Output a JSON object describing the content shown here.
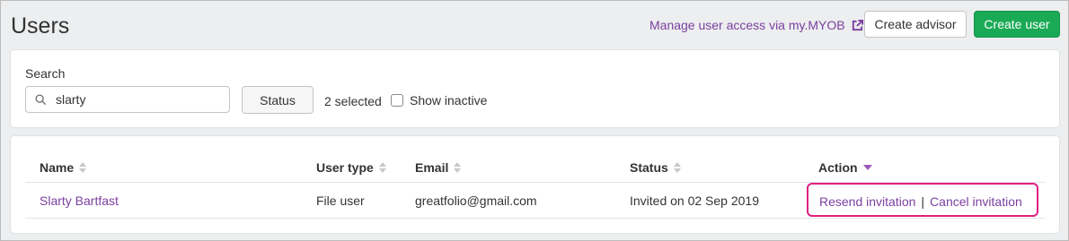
{
  "header": {
    "title": "Users",
    "manage_link": "Manage user access via my.MYOB",
    "create_advisor": "Create advisor",
    "create_user": "Create user"
  },
  "search": {
    "label": "Search",
    "value": "slarty",
    "status_button": "Status",
    "selected_count": "2 selected",
    "show_inactive": "Show inactive"
  },
  "table": {
    "columns": [
      "Name",
      "User type",
      "Email",
      "Status",
      "Action"
    ],
    "rows": [
      {
        "name": "Slarty Bartfast",
        "user_type": "File user",
        "email": "greatfolio@gmail.com",
        "status": "Invited on 02 Sep 2019",
        "actions": [
          "Resend invitation",
          "Cancel invitation"
        ]
      }
    ],
    "action_separator": "|"
  },
  "colors": {
    "link": "#7b3fa0",
    "primary": "#1aaa55",
    "highlight": "#e0207e"
  }
}
